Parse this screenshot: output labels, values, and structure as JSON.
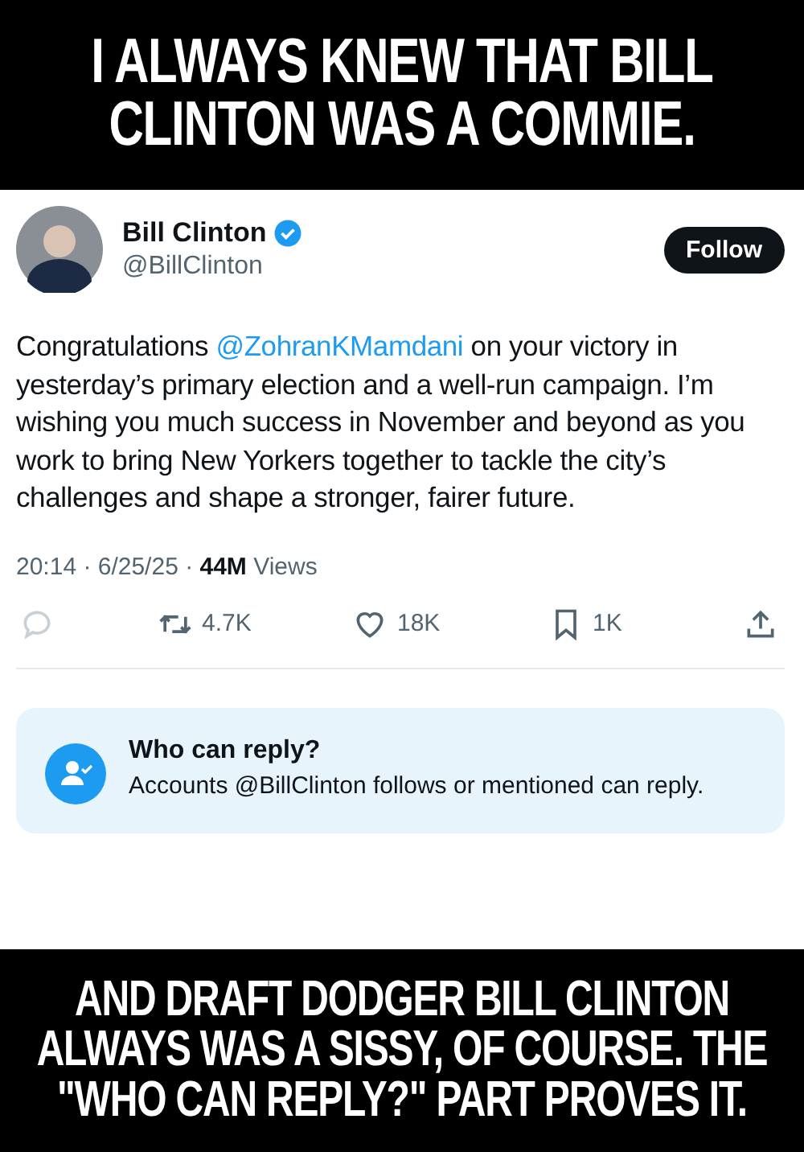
{
  "top_caption": "I ALWAYS KNEW THAT BILL CLINTON WAS A COMMIE.",
  "tweet": {
    "author": {
      "name": "Bill Clinton",
      "verified": true,
      "handle": "@BillClinton"
    },
    "follow_button": "Follow",
    "body": {
      "before": "Congratulations",
      "mention": "@ZohranKMamdani",
      "after": "on your victory in yesterday’s primary election and a well-run campaign. I’m wishing you much success in November and beyond as you work to bring New Yorkers together to tackle the city’s challenges and shape a stronger, fairer future."
    },
    "meta": "20:14 · 6/25/25 · **44M** Views",
    "actions": [
      {
        "kind": "reply",
        "disabled": true
      },
      {
        "kind": "repost",
        "count": "4.7K"
      },
      {
        "kind": "like",
        "count": "18K"
      },
      {
        "kind": "bookmark",
        "count": "1K"
      },
      {
        "kind": "share"
      }
    ],
    "reply_notice": {
      "title": "Who can reply?",
      "text": "Accounts @BillClinton follows or mentioned can reply."
    }
  },
  "bottom_caption": "AND DRAFT DODGER BILL CLINTON ALWAYS WAS A SISSY, OF COURSE. THE \"WHO CAN REPLY?\" PART PROVES IT."
}
